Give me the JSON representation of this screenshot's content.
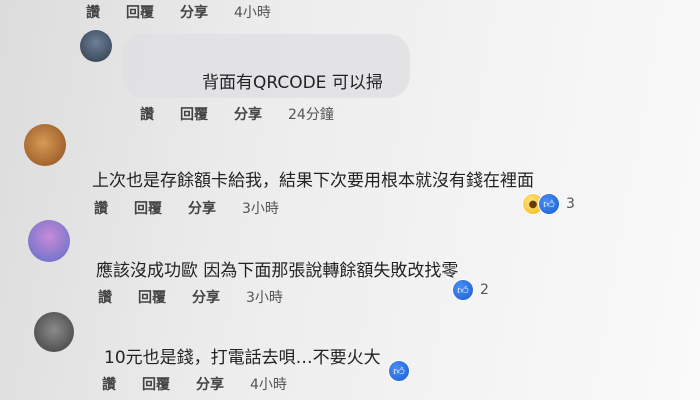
{
  "comments": [
    {
      "actions": {
        "like": "讚",
        "reply": "回覆",
        "share": "分享",
        "time": "4小時"
      }
    },
    {
      "author": "",
      "text": "背面有QRCODE 可以掃",
      "actions": {
        "like": "讚",
        "reply": "回覆",
        "share": "分享",
        "time": "24分鐘"
      }
    },
    {
      "author": "",
      "text": "上次也是存餘額卡給我，結果下次要用根本就沒有錢在裡面",
      "actions": {
        "like": "讚",
        "reply": "回覆",
        "share": "分享",
        "time": "3小時"
      },
      "reaction_count": "3",
      "reaction_icons": [
        "wow-icon",
        "like-icon"
      ]
    },
    {
      "author": "",
      "text": "應該沒成功歐 因為下面那張說轉餘額失敗改找零",
      "actions": {
        "like": "讚",
        "reply": "回覆",
        "share": "分享",
        "time": "3小時"
      },
      "reaction_count": "2",
      "reaction_icons": [
        "like-icon"
      ]
    },
    {
      "text": "10元也是錢，打電話去唄…不要火大",
      "actions": {
        "like": "讚",
        "reply": "回覆",
        "share": "分享",
        "time": "4小時"
      },
      "reaction_icons": [
        "like-icon"
      ]
    }
  ],
  "colors": {
    "like_blue": "#1a5fd1",
    "bubble": "#e1e1e4"
  }
}
